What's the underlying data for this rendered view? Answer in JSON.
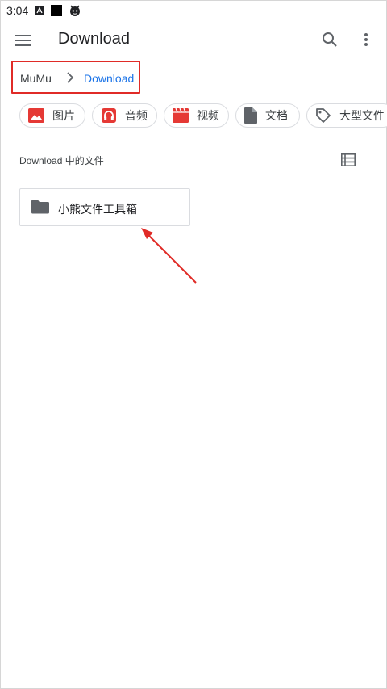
{
  "status_bar": {
    "time": "3:04"
  },
  "toolbar": {
    "title": "Download"
  },
  "breadcrumb": {
    "root": "MuMu",
    "current": "Download"
  },
  "chips": [
    {
      "label": "图片",
      "icon": "image-icon",
      "color": "#e53935"
    },
    {
      "label": "音频",
      "icon": "headphones-icon",
      "color": "#e53935"
    },
    {
      "label": "视频",
      "icon": "video-icon",
      "color": "#e53935"
    },
    {
      "label": "文档",
      "icon": "document-icon",
      "color": "#5f6368"
    },
    {
      "label": "大型文件",
      "icon": "tag-icon",
      "color": "#5f6368"
    }
  ],
  "section": {
    "header": "Download 中的文件"
  },
  "files": [
    {
      "name": "小熊文件工具箱",
      "icon": "folder-icon"
    }
  ],
  "colors": {
    "accent": "#1a73e8",
    "highlight_box": "#e02b27",
    "annotation_arrow": "#e02b27",
    "chip_media": "#e53935"
  }
}
